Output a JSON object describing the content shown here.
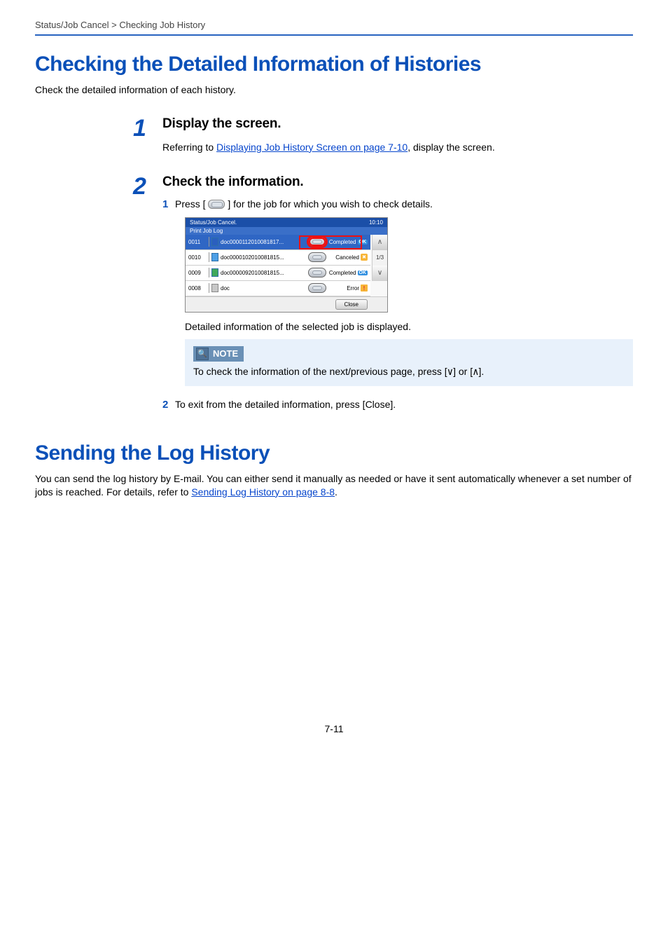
{
  "breadcrumb": "Status/Job Cancel > Checking Job History",
  "section1": {
    "title": "Checking the Detailed Information of Histories",
    "intro": "Check the detailed information of each history."
  },
  "step1": {
    "num": "1",
    "heading": "Display the screen.",
    "prefix": "Referring to ",
    "link": "Displaying Job History Screen on page 7-10",
    "suffix": ", display the screen."
  },
  "step2": {
    "num": "2",
    "heading": "Check the information.",
    "sub1": {
      "num": "1",
      "prefix": "Press [",
      "suffix": "] for the job for which you wish to check details."
    },
    "afterScreenshot": "Detailed information of the selected job is displayed.",
    "note": {
      "label": "NOTE",
      "text_prefix": "To check the information of the next/previous page, press [",
      "down": "∨",
      "mid": "] or [",
      "up": "∧",
      "text_suffix": "]."
    },
    "sub2": {
      "num": "2",
      "text": "To exit from the detailed information, press [Close]."
    }
  },
  "screenshot": {
    "headerLeft": "Status/Job Cancel.",
    "headerRight": "10:10",
    "tab": "Print Job Log",
    "pageIndicator": "1/3",
    "upArrow": "∧",
    "downArrow": "∨",
    "closeLabel": "Close",
    "rows": [
      {
        "id": "0011",
        "name": "doc0000112010081817...",
        "status": "Completed",
        "badge": "OK",
        "selected": true,
        "docClass": "word"
      },
      {
        "id": "0010",
        "name": "doc0000102010081815...",
        "status": "Canceled",
        "badge": "cancel",
        "selected": false,
        "docClass": ""
      },
      {
        "id": "0009",
        "name": "doc0000092010081815...",
        "status": "Completed",
        "badge": "OK",
        "selected": false,
        "docClass": "excel"
      },
      {
        "id": "0008",
        "name": "doc",
        "status": "Error",
        "badge": "!",
        "selected": false,
        "docClass": "gray"
      }
    ]
  },
  "section2": {
    "title": "Sending the Log History",
    "para_prefix": "You can send the log history by E-mail. You can either send it manually as needed or have it sent automatically whenever a set number of jobs is reached. For details, refer to ",
    "link": "Sending Log History on page 8-8",
    "para_suffix": "."
  },
  "pageNumber": "7-11"
}
